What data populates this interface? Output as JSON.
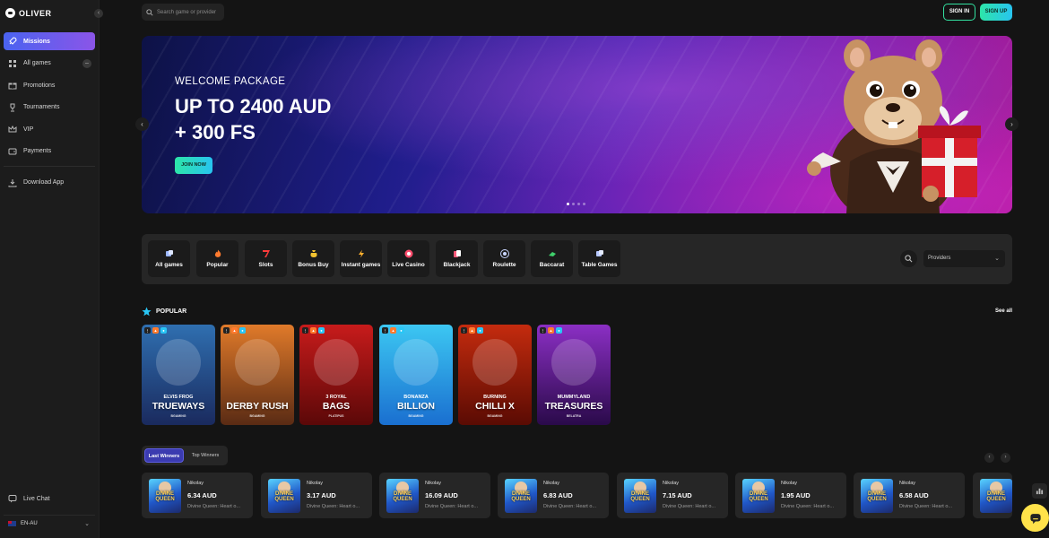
{
  "brand": {
    "name": "OLIVER"
  },
  "search": {
    "placeholder": "Search game or provider"
  },
  "auth": {
    "signin": "SIGN IN",
    "signup": "SIGN UP"
  },
  "sidebar": {
    "items": [
      {
        "label": "Missions",
        "icon": "rocket-icon",
        "active": true
      },
      {
        "label": "All games",
        "icon": "grid-icon",
        "active": false
      },
      {
        "label": "Promotions",
        "icon": "gift-icon",
        "active": false
      },
      {
        "label": "Tournaments",
        "icon": "trophy-icon",
        "active": false
      },
      {
        "label": "VIP",
        "icon": "crown-icon",
        "active": false
      },
      {
        "label": "Payments",
        "icon": "wallet-icon",
        "active": false
      }
    ],
    "download": "Download App",
    "live_chat": "Live Chat",
    "language": "EN-AU"
  },
  "banner": {
    "pretitle": "WELCOME PACKAGE",
    "title_line1": "UP TO 2400 AUD",
    "title_line2": "+ 300 FS",
    "cta": "JOIN NOW"
  },
  "categories": [
    {
      "label": "All games",
      "icon": "dice-icon",
      "color": "#9db8ff"
    },
    {
      "label": "Popular",
      "icon": "flame-icon",
      "color": "#ff7a2e"
    },
    {
      "label": "Slots",
      "icon": "seven-icon",
      "color": "#ff3b3b"
    },
    {
      "label": "Bonus Buy",
      "icon": "bag-icon",
      "color": "#f2c230"
    },
    {
      "label": "Instant games",
      "icon": "bolt-icon",
      "color": "#ffb02e"
    },
    {
      "label": "Live Casino",
      "icon": "chip-icon",
      "color": "#ff4d6d"
    },
    {
      "label": "Blackjack",
      "icon": "cards-icon",
      "color": "#ff5b7b"
    },
    {
      "label": "Roulette",
      "icon": "roulette-icon",
      "color": "#c9d6ff"
    },
    {
      "label": "Baccarat",
      "icon": "baccarat-icon",
      "color": "#3fcf6b"
    },
    {
      "label": "Table Games",
      "icon": "table-icon",
      "color": "#b7c8ff"
    }
  ],
  "providers": {
    "label": "Providers"
  },
  "popular": {
    "heading": "POPULAR",
    "see_all": "See all",
    "games": [
      {
        "sub": "ELVIS FROG",
        "main": "TRUEWAYS",
        "provider": "BGAMING",
        "bg1": "#2f6fb0",
        "bg2": "#1a2a5e"
      },
      {
        "sub": "",
        "main": "DERBY RUSH",
        "provider": "BGAMING",
        "bg1": "#e07a2a",
        "bg2": "#5a2b14"
      },
      {
        "sub": "3 ROYAL",
        "main": "BAGS",
        "provider": "PLATIPUS",
        "bg1": "#c71b1b",
        "bg2": "#5b0808"
      },
      {
        "sub": "BONANZA",
        "main": "BILLION",
        "provider": "BGAMING",
        "bg1": "#3cc7f2",
        "bg2": "#1a6fd0"
      },
      {
        "sub": "BURNING",
        "main": "CHILLI X",
        "provider": "BGAMING",
        "bg1": "#c42b0e",
        "bg2": "#5a0b03"
      },
      {
        "sub": "MUMMYLAND",
        "main": "TREASURES",
        "provider": "BELATRA",
        "bg1": "#8b2fc4",
        "bg2": "#2a0a4a"
      }
    ]
  },
  "winners": {
    "tab_last": "Last Winners",
    "tab_top": "Top Winners",
    "list": [
      {
        "name": "Nikolay",
        "amount": "6.34 AUD",
        "game": "Divine Queen: Heart o...",
        "thumb": "DIVINE QUEEN"
      },
      {
        "name": "Nikolay",
        "amount": "3.17 AUD",
        "game": "Divine Queen: Heart o...",
        "thumb": "DIVINE QUEEN"
      },
      {
        "name": "Nikolay",
        "amount": "16.09 AUD",
        "game": "Divine Queen: Heart o...",
        "thumb": "DIVINE QUEEN"
      },
      {
        "name": "Nikolay",
        "amount": "6.83 AUD",
        "game": "Divine Queen: Heart o...",
        "thumb": "DIVINE QUEEN"
      },
      {
        "name": "Nikolay",
        "amount": "7.15 AUD",
        "game": "Divine Queen: Heart o...",
        "thumb": "DIVINE QUEEN"
      },
      {
        "name": "Nikolay",
        "amount": "1.95 AUD",
        "game": "Divine Queen: Heart o...",
        "thumb": "DIVINE QUEEN"
      },
      {
        "name": "Nikolay",
        "amount": "6.58 AUD",
        "game": "Divine Queen: Heart o...",
        "thumb": "DIVINE QUEEN"
      },
      {
        "name": "",
        "amount": "",
        "game": "",
        "thumb": "DIVINE QUEEN"
      }
    ]
  }
}
